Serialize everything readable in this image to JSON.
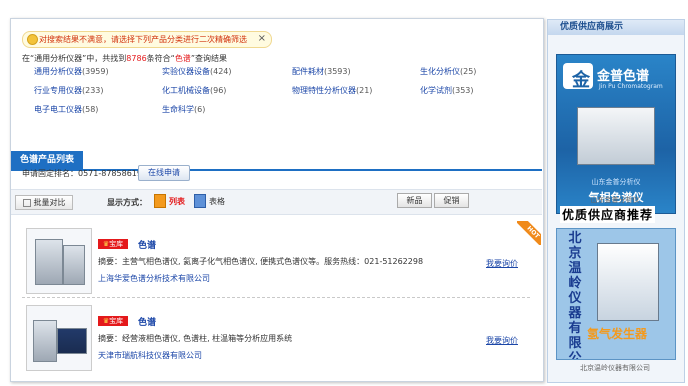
{
  "tip": {
    "text": "对搜索结果不满意，请选择下列产品分类进行二次精确筛选",
    "close": "×"
  },
  "found": {
    "prefix": "在“通用分析仪器”中，共找到",
    "count": "8786",
    "middle": "条符合“",
    "keyword": "色谱",
    "suffix": "”查询结果"
  },
  "categories": [
    {
      "name": "通用分析仪器",
      "count": "(3959)"
    },
    {
      "name": "实验仪器设备",
      "count": "(424)"
    },
    {
      "name": "配件耗材",
      "count": "(3593)"
    },
    {
      "name": "生化分析仪",
      "count": "(25)"
    },
    {
      "name": "行业专用仪器",
      "count": "(233)"
    },
    {
      "name": "化工机械设备",
      "count": "(96)"
    },
    {
      "name": "物理特性分析仪器",
      "count": "(21)"
    },
    {
      "name": "化学试剂",
      "count": "(353)"
    },
    {
      "name": "电子电工仪器",
      "count": "(58)"
    },
    {
      "name": "生命科学",
      "count": "(6)"
    }
  ],
  "tab": {
    "label": "色谱产品列表"
  },
  "apply": {
    "text": "申请固定排名：0571-87858619",
    "button": "在线申请"
  },
  "toolbar": {
    "compare": "批量对比",
    "display_mode": "显示方式：",
    "list": "列表",
    "table": "表格",
    "new": "新品",
    "promo": "促销"
  },
  "hot_tag": "HOT",
  "products": [
    {
      "badge": "宝库",
      "title": "色谱",
      "summary": "摘要：主营气相色谱仪, 氦离子化气相色谱仪, 便携式色谱仪等。服务热线：021-51262298",
      "company": "上海华爱色谱分析技术有限公司",
      "inquiry": "我要询价"
    },
    {
      "badge": "宝库",
      "title": "色谱",
      "summary": "摘要：经营液相色谱仪, 色谱柱, 柱温箱等分析应用系统",
      "company": "天津市瑞航科技仪器有限公司",
      "inquiry": "我要询价"
    }
  ],
  "sidebar": {
    "header": "优质供应商展示",
    "ad1": {
      "logo": "金",
      "brand": "金普色谱",
      "brand_en": "Jin Pu Chromatogram",
      "subtitle": "山东金普分析仪",
      "product": "气相色谱仪",
      "caption": "山东金普分析仪"
    },
    "title": "优质供应商推荐",
    "ad2": {
      "vertical": "北京温岭仪器有限公司",
      "product": "氢气发生器",
      "caption": "北京温岭仪器有限公司"
    }
  }
}
